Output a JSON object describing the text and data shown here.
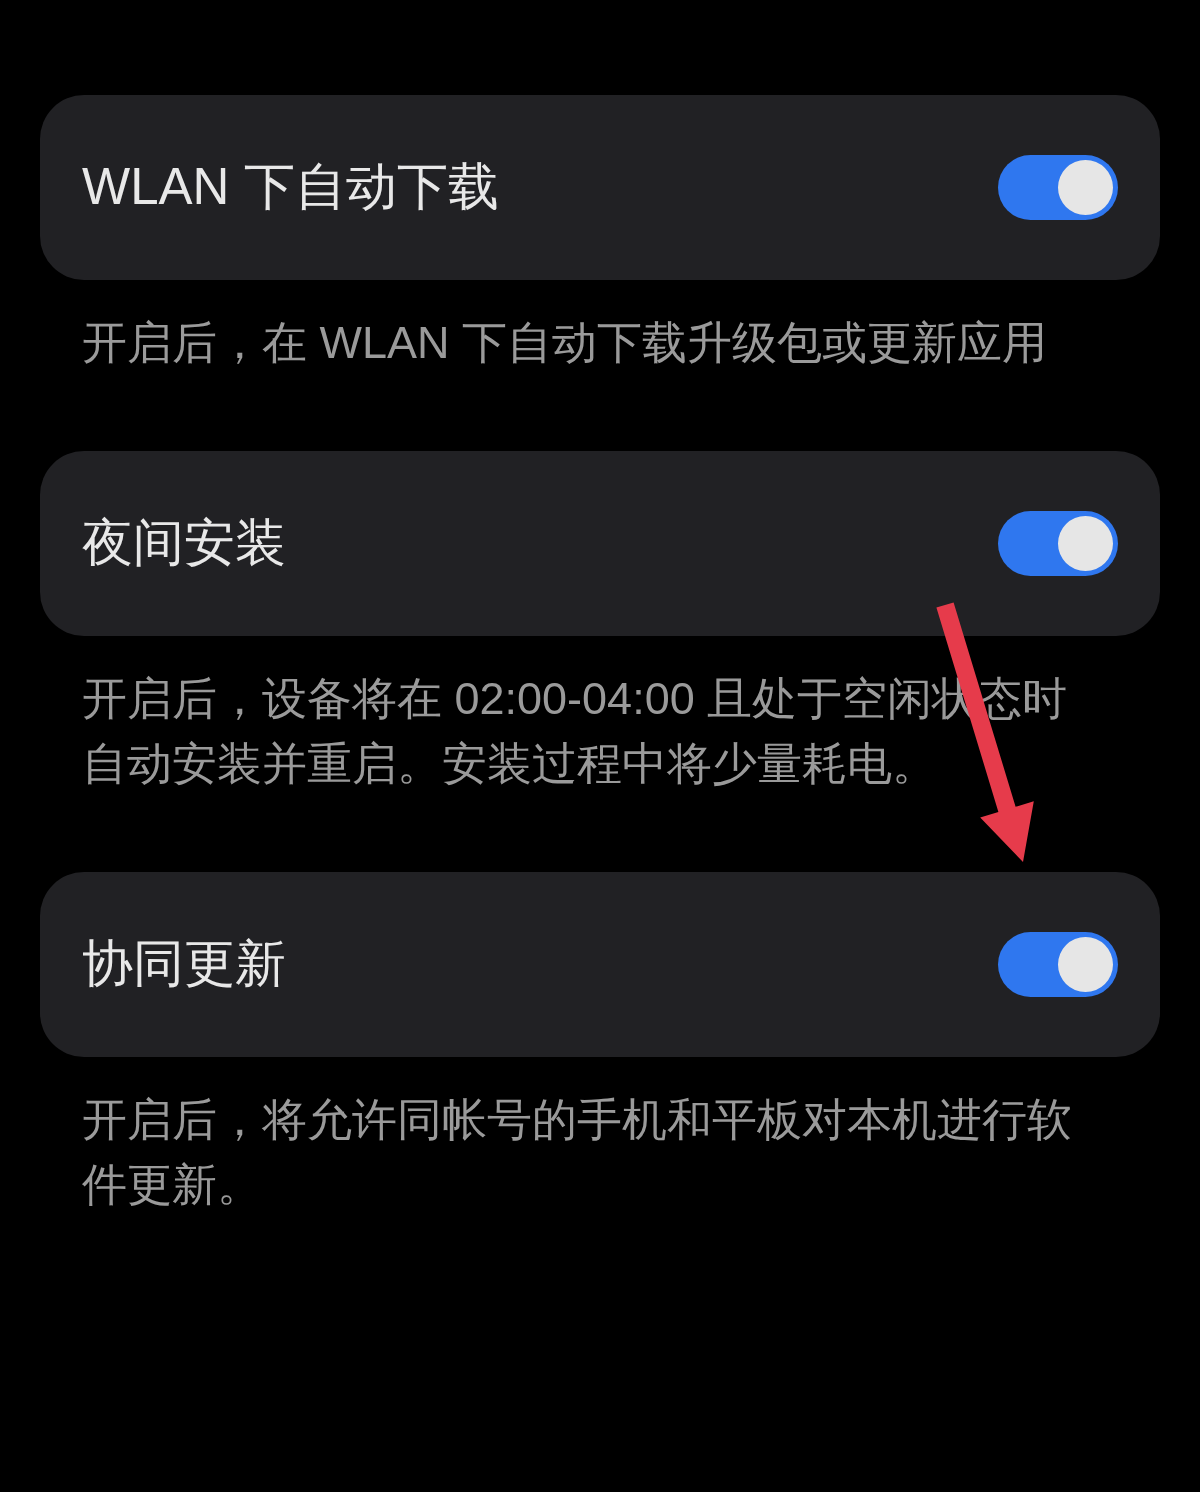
{
  "settings": [
    {
      "title": "WLAN 下自动下载",
      "on": true,
      "description": "开启后，在 WLAN 下自动下载升级包或更新应用"
    },
    {
      "title": "夜间安装",
      "on": true,
      "description": "开启后，设备将在 02:00-04:00 且处于空闲状态时自动安装并重启。安装过程中将少量耗电。"
    },
    {
      "title": "协同更新",
      "on": true,
      "description": "开启后，将允许同帐号的手机和平板对本机进行软件更新。"
    }
  ]
}
